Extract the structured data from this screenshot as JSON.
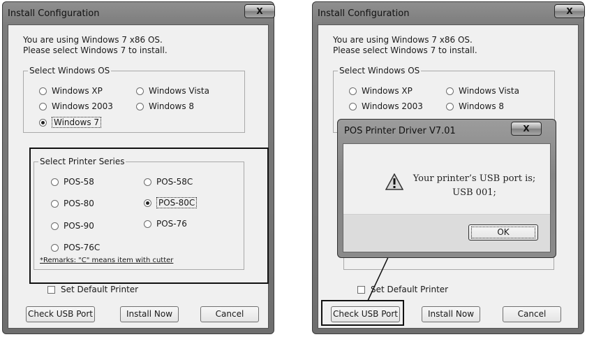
{
  "window": {
    "title": "Install Configuration",
    "close_glyph": "X",
    "message_line1": "You are using Windows 7 x86 OS.",
    "message_line2": "Please select Windows 7 to install.",
    "os_group_label": "Select Windows OS",
    "os_options": [
      "Windows XP",
      "Windows Vista",
      "Windows 2003",
      "Windows 8",
      "Windows 7"
    ],
    "os_selected": "Windows 7",
    "printer_group_label": "Select Printer Series",
    "printer_options": [
      "POS-58",
      "POS-58C",
      "POS-80",
      "POS-80C",
      "POS-90",
      "POS-76",
      "POS-76C"
    ],
    "printer_selected": "POS-80C",
    "remarks": "*Remarks: \"C\" means item with cutter",
    "set_default_label": "Set Default Printer",
    "check_usb_button": "Check USB Port",
    "install_button": "Install Now",
    "cancel_button": "Cancel"
  },
  "dialog": {
    "title": "POS Printer Driver V7.01",
    "close_glyph": "X",
    "icon": "warning-icon",
    "message_line1": "Your printer’s USB port is;",
    "message_line2": "USB 001;",
    "ok_button": "OK"
  }
}
